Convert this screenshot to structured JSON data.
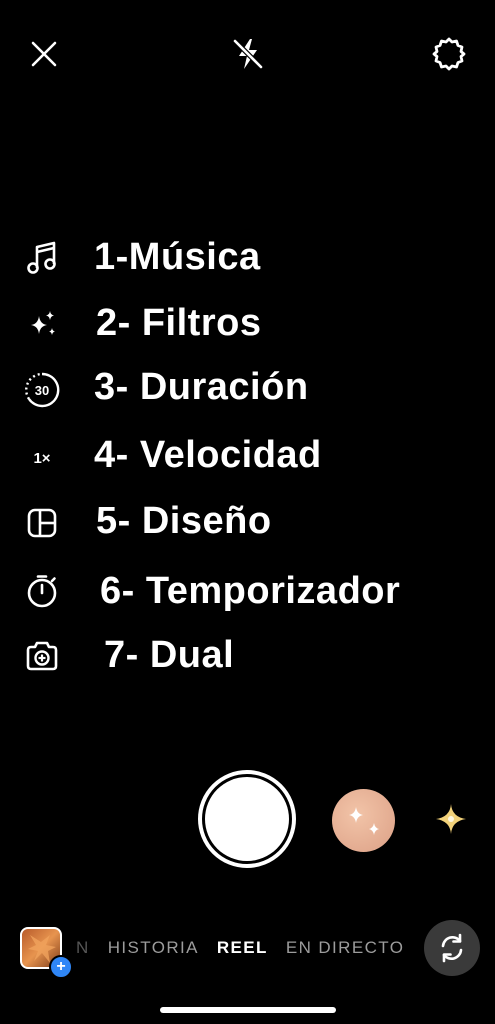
{
  "top_bar": {
    "close_icon": "close-icon",
    "flash_icon": "flash-off-icon",
    "settings_icon": "gear-icon"
  },
  "menu": {
    "items": [
      {
        "icon": "music-note-icon",
        "label": "1-Música"
      },
      {
        "icon": "sparkles-icon",
        "label": "2- Filtros"
      },
      {
        "icon": "duration-icon",
        "label": "3- Duración",
        "icon_text": "30"
      },
      {
        "icon": "speed-icon",
        "label": "4- Velocidad",
        "icon_text": "1×"
      },
      {
        "icon": "layout-icon",
        "label": "5- Diseño"
      },
      {
        "icon": "timer-icon",
        "label": "6- Temporizador"
      },
      {
        "icon": "dual-camera-icon",
        "label": "7- Dual"
      }
    ]
  },
  "capture": {
    "shutter_icon": "shutter-button",
    "effect_icon": "effect-sparkle-icon"
  },
  "modes": {
    "partial_left": "N",
    "items": [
      "HISTORIA",
      "REEL",
      "EN DIRECTO"
    ],
    "active": "REEL"
  },
  "bottom": {
    "gallery_icon": "gallery-thumbnail",
    "gallery_plus": "+",
    "flip_icon": "flip-camera-icon"
  }
}
